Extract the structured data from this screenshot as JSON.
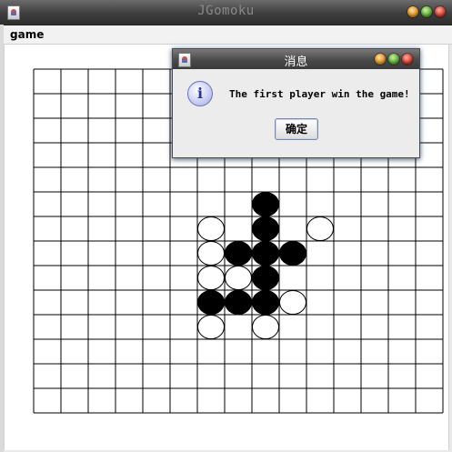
{
  "window": {
    "title": "JGomoku",
    "icon": "java-cup-icon",
    "controls": [
      "minimize-icon",
      "maximize-icon",
      "close-icon"
    ]
  },
  "menubar": {
    "items": [
      {
        "label": "game"
      }
    ]
  },
  "board": {
    "columns": 15,
    "rows": 14,
    "line_color": "#000000",
    "background": "#ffffff",
    "stones": [
      {
        "col": 8,
        "row": 5,
        "color": "black"
      },
      {
        "col": 6,
        "row": 6,
        "color": "white"
      },
      {
        "col": 8,
        "row": 6,
        "color": "black"
      },
      {
        "col": 10,
        "row": 6,
        "color": "white"
      },
      {
        "col": 6,
        "row": 7,
        "color": "white"
      },
      {
        "col": 7,
        "row": 7,
        "color": "black"
      },
      {
        "col": 8,
        "row": 7,
        "color": "black"
      },
      {
        "col": 9,
        "row": 7,
        "color": "black"
      },
      {
        "col": 6,
        "row": 8,
        "color": "white"
      },
      {
        "col": 7,
        "row": 8,
        "color": "white"
      },
      {
        "col": 8,
        "row": 8,
        "color": "black"
      },
      {
        "col": 6,
        "row": 9,
        "color": "black"
      },
      {
        "col": 7,
        "row": 9,
        "color": "black"
      },
      {
        "col": 8,
        "row": 9,
        "color": "black"
      },
      {
        "col": 9,
        "row": 9,
        "color": "white"
      },
      {
        "col": 6,
        "row": 10,
        "color": "white"
      },
      {
        "col": 8,
        "row": 10,
        "color": "white"
      }
    ]
  },
  "dialog": {
    "title": "消息",
    "icon": "info-icon",
    "icon_glyph": "i",
    "message": "The first player win the game!",
    "ok_label": "确定",
    "controls": [
      "minimize-icon",
      "maximize-icon",
      "close-icon"
    ]
  }
}
